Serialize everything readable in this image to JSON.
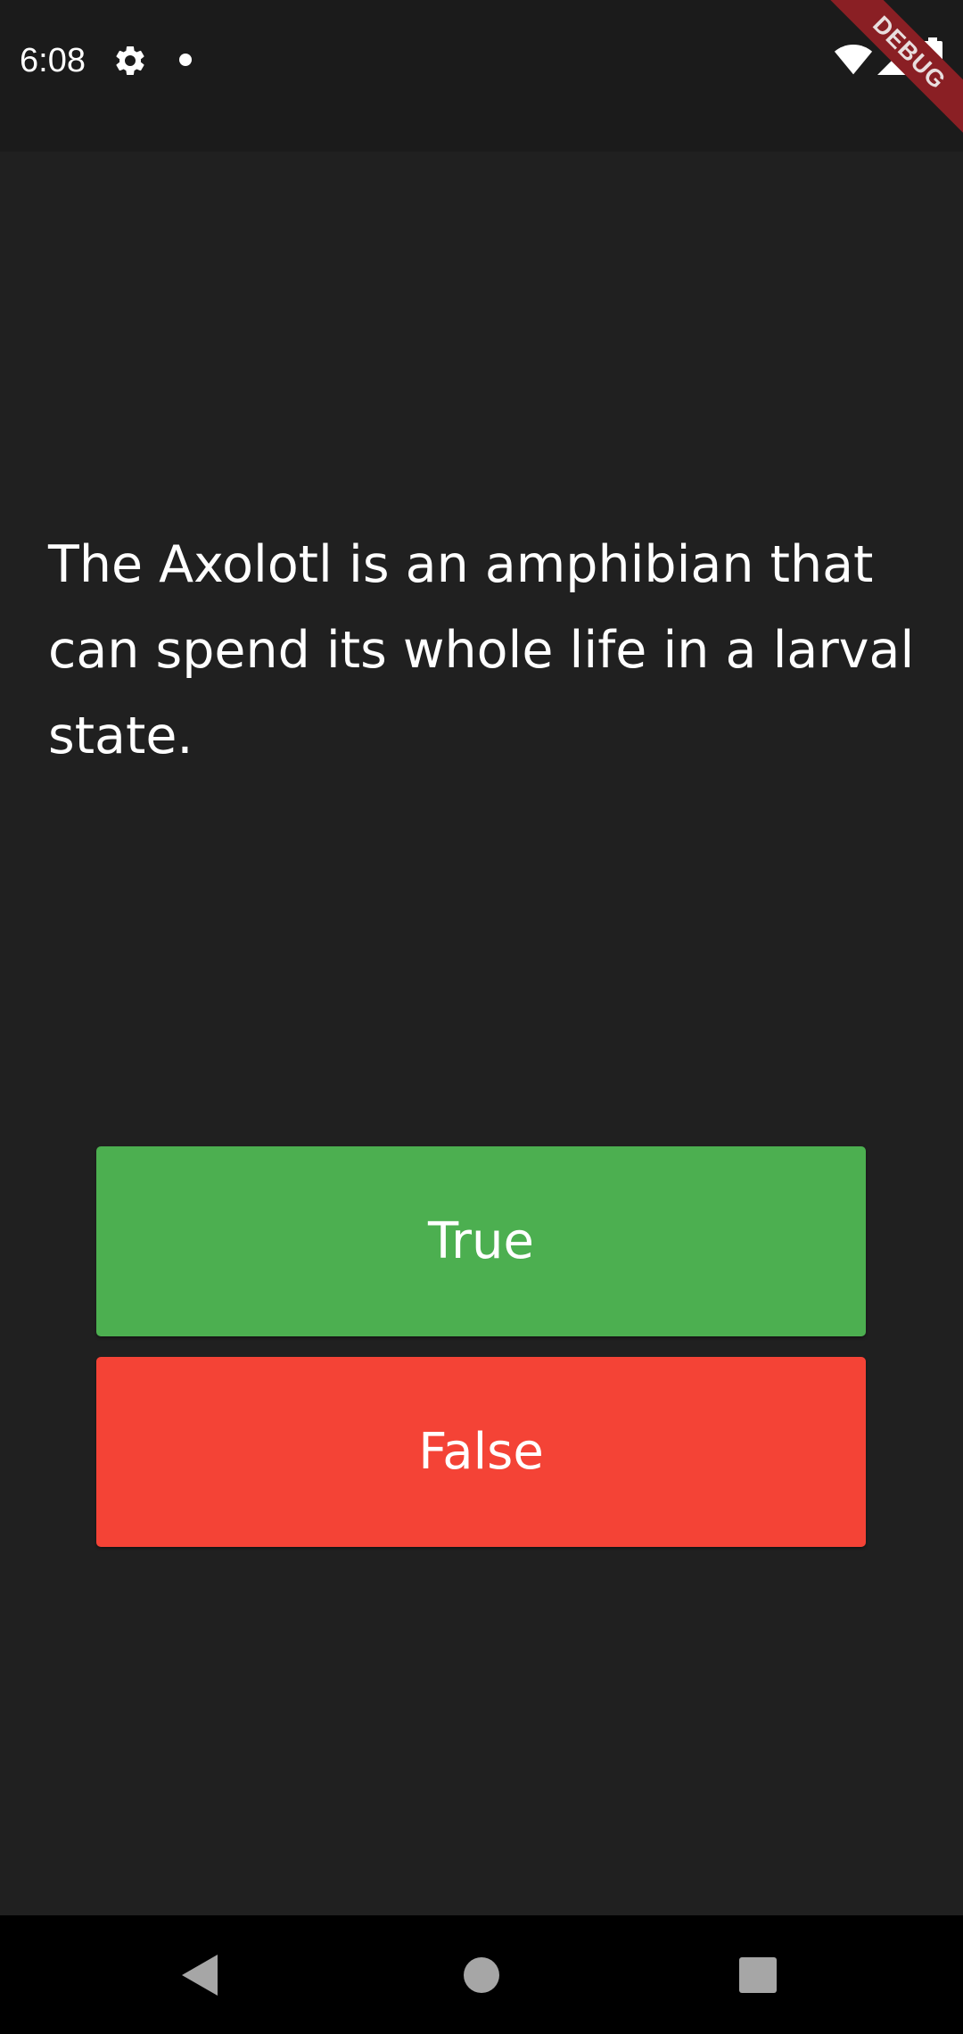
{
  "status_bar": {
    "time": "6:08",
    "icons": [
      "gear-icon",
      "notification-dot-icon",
      "wifi-icon",
      "cell-signal-icon",
      "battery-icon"
    ]
  },
  "debug_banner": {
    "label": "DEBUG",
    "color": "#8a1f24"
  },
  "quiz": {
    "question": "The Axolotl is an amphibian that can spend its whole life in a larval state.",
    "true_label": "True",
    "false_label": "False"
  },
  "colors": {
    "background": "#202020",
    "true_button": "#4caf50",
    "false_button": "#f44336"
  },
  "nav_bar": {
    "buttons": [
      "back-icon",
      "home-icon",
      "recents-icon"
    ]
  }
}
